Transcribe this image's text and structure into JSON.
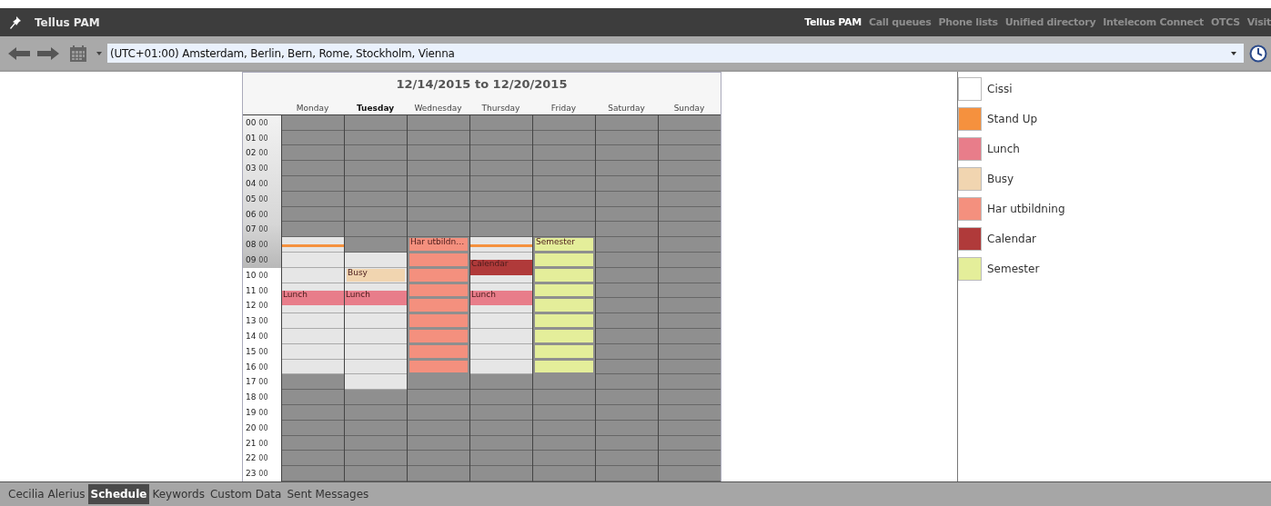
{
  "app": {
    "title": "Tellus PAM"
  },
  "nav": [
    {
      "label": "Tellus PAM",
      "selected": true
    },
    {
      "label": "Call queues",
      "selected": false
    },
    {
      "label": "Phone lists",
      "selected": false
    },
    {
      "label": "Unified directory",
      "selected": false
    },
    {
      "label": "Intelecom Connect",
      "selected": false
    },
    {
      "label": "OTCS",
      "selected": false
    },
    {
      "label": "Visit",
      "selected": false
    }
  ],
  "toolbar": {
    "timezone": "(UTC+01:00) Amsterdam, Berlin, Bern, Rome, Stockholm, Vienna"
  },
  "calendar": {
    "title": "12/14/2015 to 12/20/2015",
    "hours": [
      {
        "hour": "00",
        "minute": "00"
      },
      {
        "hour": "01",
        "minute": "00"
      },
      {
        "hour": "02",
        "minute": "00"
      },
      {
        "hour": "03",
        "minute": "00"
      },
      {
        "hour": "04",
        "minute": "00"
      },
      {
        "hour": "05",
        "minute": "00"
      },
      {
        "hour": "06",
        "minute": "00"
      },
      {
        "hour": "07",
        "minute": "00"
      },
      {
        "hour": "08",
        "minute": "00"
      },
      {
        "hour": "09",
        "minute": "00"
      },
      {
        "hour": "10",
        "minute": "00"
      },
      {
        "hour": "11",
        "minute": "00"
      },
      {
        "hour": "12",
        "minute": "00"
      },
      {
        "hour": "13",
        "minute": "00"
      },
      {
        "hour": "14",
        "minute": "00"
      },
      {
        "hour": "15",
        "minute": "00"
      },
      {
        "hour": "16",
        "minute": "00"
      },
      {
        "hour": "17",
        "minute": "00"
      },
      {
        "hour": "18",
        "minute": "00"
      },
      {
        "hour": "19",
        "minute": "00"
      },
      {
        "hour": "20",
        "minute": "00"
      },
      {
        "hour": "21",
        "minute": "00"
      },
      {
        "hour": "22",
        "minute": "00"
      },
      {
        "hour": "23",
        "minute": "00"
      }
    ],
    "days": [
      {
        "name": "Monday",
        "today": false,
        "cells": [
          {
            "kind": "off"
          },
          {
            "kind": "off"
          },
          {
            "kind": "off"
          },
          {
            "kind": "off"
          },
          {
            "kind": "off"
          },
          {
            "kind": "off"
          },
          {
            "kind": "off"
          },
          {
            "kind": "off"
          },
          {
            "kind": "free",
            "events": [
              {
                "kind": "stripe",
                "color": "#f5913e"
              }
            ]
          },
          {
            "kind": "free"
          },
          {
            "kind": "free"
          },
          {
            "kind": "free",
            "events": [
              {
                "kind": "lower",
                "title": "Lunch",
                "color": "#e87d8a"
              }
            ]
          },
          {
            "kind": "free",
            "events": [
              {
                "kind": "upper",
                "color": "#e87d8a"
              }
            ]
          },
          {
            "kind": "free"
          },
          {
            "kind": "free"
          },
          {
            "kind": "free"
          },
          {
            "kind": "free"
          },
          {
            "kind": "off"
          },
          {
            "kind": "off"
          },
          {
            "kind": "off"
          },
          {
            "kind": "off"
          },
          {
            "kind": "off"
          },
          {
            "kind": "off"
          },
          {
            "kind": "off"
          }
        ]
      },
      {
        "name": "Tuesday",
        "today": true,
        "cells": [
          {
            "kind": "off"
          },
          {
            "kind": "off"
          },
          {
            "kind": "off"
          },
          {
            "kind": "off"
          },
          {
            "kind": "off"
          },
          {
            "kind": "off"
          },
          {
            "kind": "off"
          },
          {
            "kind": "off"
          },
          {
            "kind": "off"
          },
          {
            "kind": "free"
          },
          {
            "kind": "free",
            "events": [
              {
                "kind": "whole",
                "title": "Busy",
                "color": "#f1d5b0"
              }
            ]
          },
          {
            "kind": "free",
            "events": [
              {
                "kind": "lower",
                "title": "Lunch",
                "color": "#e87d8a"
              }
            ]
          },
          {
            "kind": "free",
            "events": [
              {
                "kind": "upper",
                "color": "#e87d8a"
              }
            ]
          },
          {
            "kind": "free"
          },
          {
            "kind": "free"
          },
          {
            "kind": "free"
          },
          {
            "kind": "free"
          },
          {
            "kind": "free"
          },
          {
            "kind": "off"
          },
          {
            "kind": "off"
          },
          {
            "kind": "off"
          },
          {
            "kind": "off"
          },
          {
            "kind": "off"
          },
          {
            "kind": "off"
          }
        ]
      },
      {
        "name": "Wednesday",
        "today": false,
        "cells": [
          {
            "kind": "off"
          },
          {
            "kind": "off"
          },
          {
            "kind": "off"
          },
          {
            "kind": "off"
          },
          {
            "kind": "off"
          },
          {
            "kind": "off"
          },
          {
            "kind": "off"
          },
          {
            "kind": "off"
          },
          {
            "kind": "off",
            "events": [
              {
                "kind": "whole",
                "title": "Har utbildn…",
                "color": "#f4907e"
              }
            ]
          },
          {
            "kind": "off",
            "events": [
              {
                "kind": "whole",
                "color": "#f4907e"
              }
            ]
          },
          {
            "kind": "off",
            "events": [
              {
                "kind": "whole",
                "color": "#f4907e"
              }
            ]
          },
          {
            "kind": "off",
            "events": [
              {
                "kind": "whole",
                "color": "#f4907e"
              }
            ]
          },
          {
            "kind": "off",
            "events": [
              {
                "kind": "whole",
                "color": "#f4907e"
              }
            ]
          },
          {
            "kind": "off",
            "events": [
              {
                "kind": "whole",
                "color": "#f4907e"
              }
            ]
          },
          {
            "kind": "off",
            "events": [
              {
                "kind": "whole",
                "color": "#f4907e"
              }
            ]
          },
          {
            "kind": "off",
            "events": [
              {
                "kind": "whole",
                "color": "#f4907e"
              }
            ]
          },
          {
            "kind": "off",
            "events": [
              {
                "kind": "whole",
                "color": "#f4907e"
              }
            ]
          },
          {
            "kind": "off"
          },
          {
            "kind": "off"
          },
          {
            "kind": "off"
          },
          {
            "kind": "off"
          },
          {
            "kind": "off"
          },
          {
            "kind": "off"
          },
          {
            "kind": "off"
          }
        ]
      },
      {
        "name": "Thursday",
        "today": false,
        "cells": [
          {
            "kind": "off"
          },
          {
            "kind": "off"
          },
          {
            "kind": "off"
          },
          {
            "kind": "off"
          },
          {
            "kind": "off"
          },
          {
            "kind": "off"
          },
          {
            "kind": "off"
          },
          {
            "kind": "off"
          },
          {
            "kind": "free",
            "events": [
              {
                "kind": "stripe",
                "color": "#f5913e"
              }
            ]
          },
          {
            "kind": "free",
            "events": [
              {
                "kind": "lower",
                "title": "Calendar",
                "color": "#b03a3a"
              }
            ]
          },
          {
            "kind": "free",
            "events": [
              {
                "kind": "upper",
                "color": "#b03a3a"
              }
            ]
          },
          {
            "kind": "free",
            "events": [
              {
                "kind": "lower",
                "title": "Lunch",
                "color": "#e87d8a"
              }
            ]
          },
          {
            "kind": "free",
            "events": [
              {
                "kind": "upper",
                "color": "#e87d8a"
              }
            ]
          },
          {
            "kind": "free"
          },
          {
            "kind": "free"
          },
          {
            "kind": "free"
          },
          {
            "kind": "free"
          },
          {
            "kind": "off"
          },
          {
            "kind": "off"
          },
          {
            "kind": "off"
          },
          {
            "kind": "off"
          },
          {
            "kind": "off"
          },
          {
            "kind": "off"
          },
          {
            "kind": "off"
          }
        ]
      },
      {
        "name": "Friday",
        "today": false,
        "cells": [
          {
            "kind": "off"
          },
          {
            "kind": "off"
          },
          {
            "kind": "off"
          },
          {
            "kind": "off"
          },
          {
            "kind": "off"
          },
          {
            "kind": "off"
          },
          {
            "kind": "off"
          },
          {
            "kind": "off"
          },
          {
            "kind": "off",
            "events": [
              {
                "kind": "whole",
                "title": "Semester",
                "color": "#e4ee9a"
              }
            ]
          },
          {
            "kind": "off",
            "events": [
              {
                "kind": "whole",
                "color": "#e4ee9a"
              }
            ]
          },
          {
            "kind": "off",
            "events": [
              {
                "kind": "whole",
                "color": "#e4ee9a"
              }
            ]
          },
          {
            "kind": "off",
            "events": [
              {
                "kind": "whole",
                "color": "#e4ee9a"
              }
            ]
          },
          {
            "kind": "off",
            "events": [
              {
                "kind": "whole",
                "color": "#e4ee9a"
              }
            ]
          },
          {
            "kind": "off",
            "events": [
              {
                "kind": "whole",
                "color": "#e4ee9a"
              }
            ]
          },
          {
            "kind": "off",
            "events": [
              {
                "kind": "whole",
                "color": "#e4ee9a"
              }
            ]
          },
          {
            "kind": "off",
            "events": [
              {
                "kind": "whole",
                "color": "#e4ee9a"
              }
            ]
          },
          {
            "kind": "off",
            "events": [
              {
                "kind": "whole",
                "color": "#e4ee9a"
              }
            ]
          },
          {
            "kind": "off"
          },
          {
            "kind": "off"
          },
          {
            "kind": "off"
          },
          {
            "kind": "off"
          },
          {
            "kind": "off"
          },
          {
            "kind": "off"
          },
          {
            "kind": "off"
          }
        ]
      },
      {
        "name": "Saturday",
        "today": false,
        "cells": [
          {
            "kind": "off"
          },
          {
            "kind": "off"
          },
          {
            "kind": "off"
          },
          {
            "kind": "off"
          },
          {
            "kind": "off"
          },
          {
            "kind": "off"
          },
          {
            "kind": "off"
          },
          {
            "kind": "off"
          },
          {
            "kind": "off"
          },
          {
            "kind": "off"
          },
          {
            "kind": "off"
          },
          {
            "kind": "off"
          },
          {
            "kind": "off"
          },
          {
            "kind": "off"
          },
          {
            "kind": "off"
          },
          {
            "kind": "off"
          },
          {
            "kind": "off"
          },
          {
            "kind": "off"
          },
          {
            "kind": "off"
          },
          {
            "kind": "off"
          },
          {
            "kind": "off"
          },
          {
            "kind": "off"
          },
          {
            "kind": "off"
          },
          {
            "kind": "off"
          }
        ]
      },
      {
        "name": "Sunday",
        "today": false,
        "cells": [
          {
            "kind": "off"
          },
          {
            "kind": "off"
          },
          {
            "kind": "off"
          },
          {
            "kind": "off"
          },
          {
            "kind": "off"
          },
          {
            "kind": "off"
          },
          {
            "kind": "off"
          },
          {
            "kind": "off"
          },
          {
            "kind": "off"
          },
          {
            "kind": "off"
          },
          {
            "kind": "off"
          },
          {
            "kind": "off"
          },
          {
            "kind": "off"
          },
          {
            "kind": "off"
          },
          {
            "kind": "off"
          },
          {
            "kind": "off"
          },
          {
            "kind": "off"
          },
          {
            "kind": "off"
          },
          {
            "kind": "off"
          },
          {
            "kind": "off"
          },
          {
            "kind": "off"
          },
          {
            "kind": "off"
          },
          {
            "kind": "off"
          },
          {
            "kind": "off"
          }
        ]
      }
    ]
  },
  "legend": [
    {
      "label": "Cissi",
      "color": "#ffffff"
    },
    {
      "label": "Stand Up",
      "color": "#f5913e"
    },
    {
      "label": "Lunch",
      "color": "#e87d8a"
    },
    {
      "label": "Busy",
      "color": "#f1d5b0"
    },
    {
      "label": "Har utbildning",
      "color": "#f4907e"
    },
    {
      "label": "Calendar",
      "color": "#b03a3a"
    },
    {
      "label": "Semester",
      "color": "#e4ee9a"
    }
  ],
  "bottom_tabs": [
    {
      "label": "Cecilia Alerius",
      "selected": false
    },
    {
      "label": "Schedule",
      "selected": true
    },
    {
      "label": "Keywords",
      "selected": false
    },
    {
      "label": "Custom Data",
      "selected": false
    },
    {
      "label": "Sent Messages",
      "selected": false
    }
  ]
}
